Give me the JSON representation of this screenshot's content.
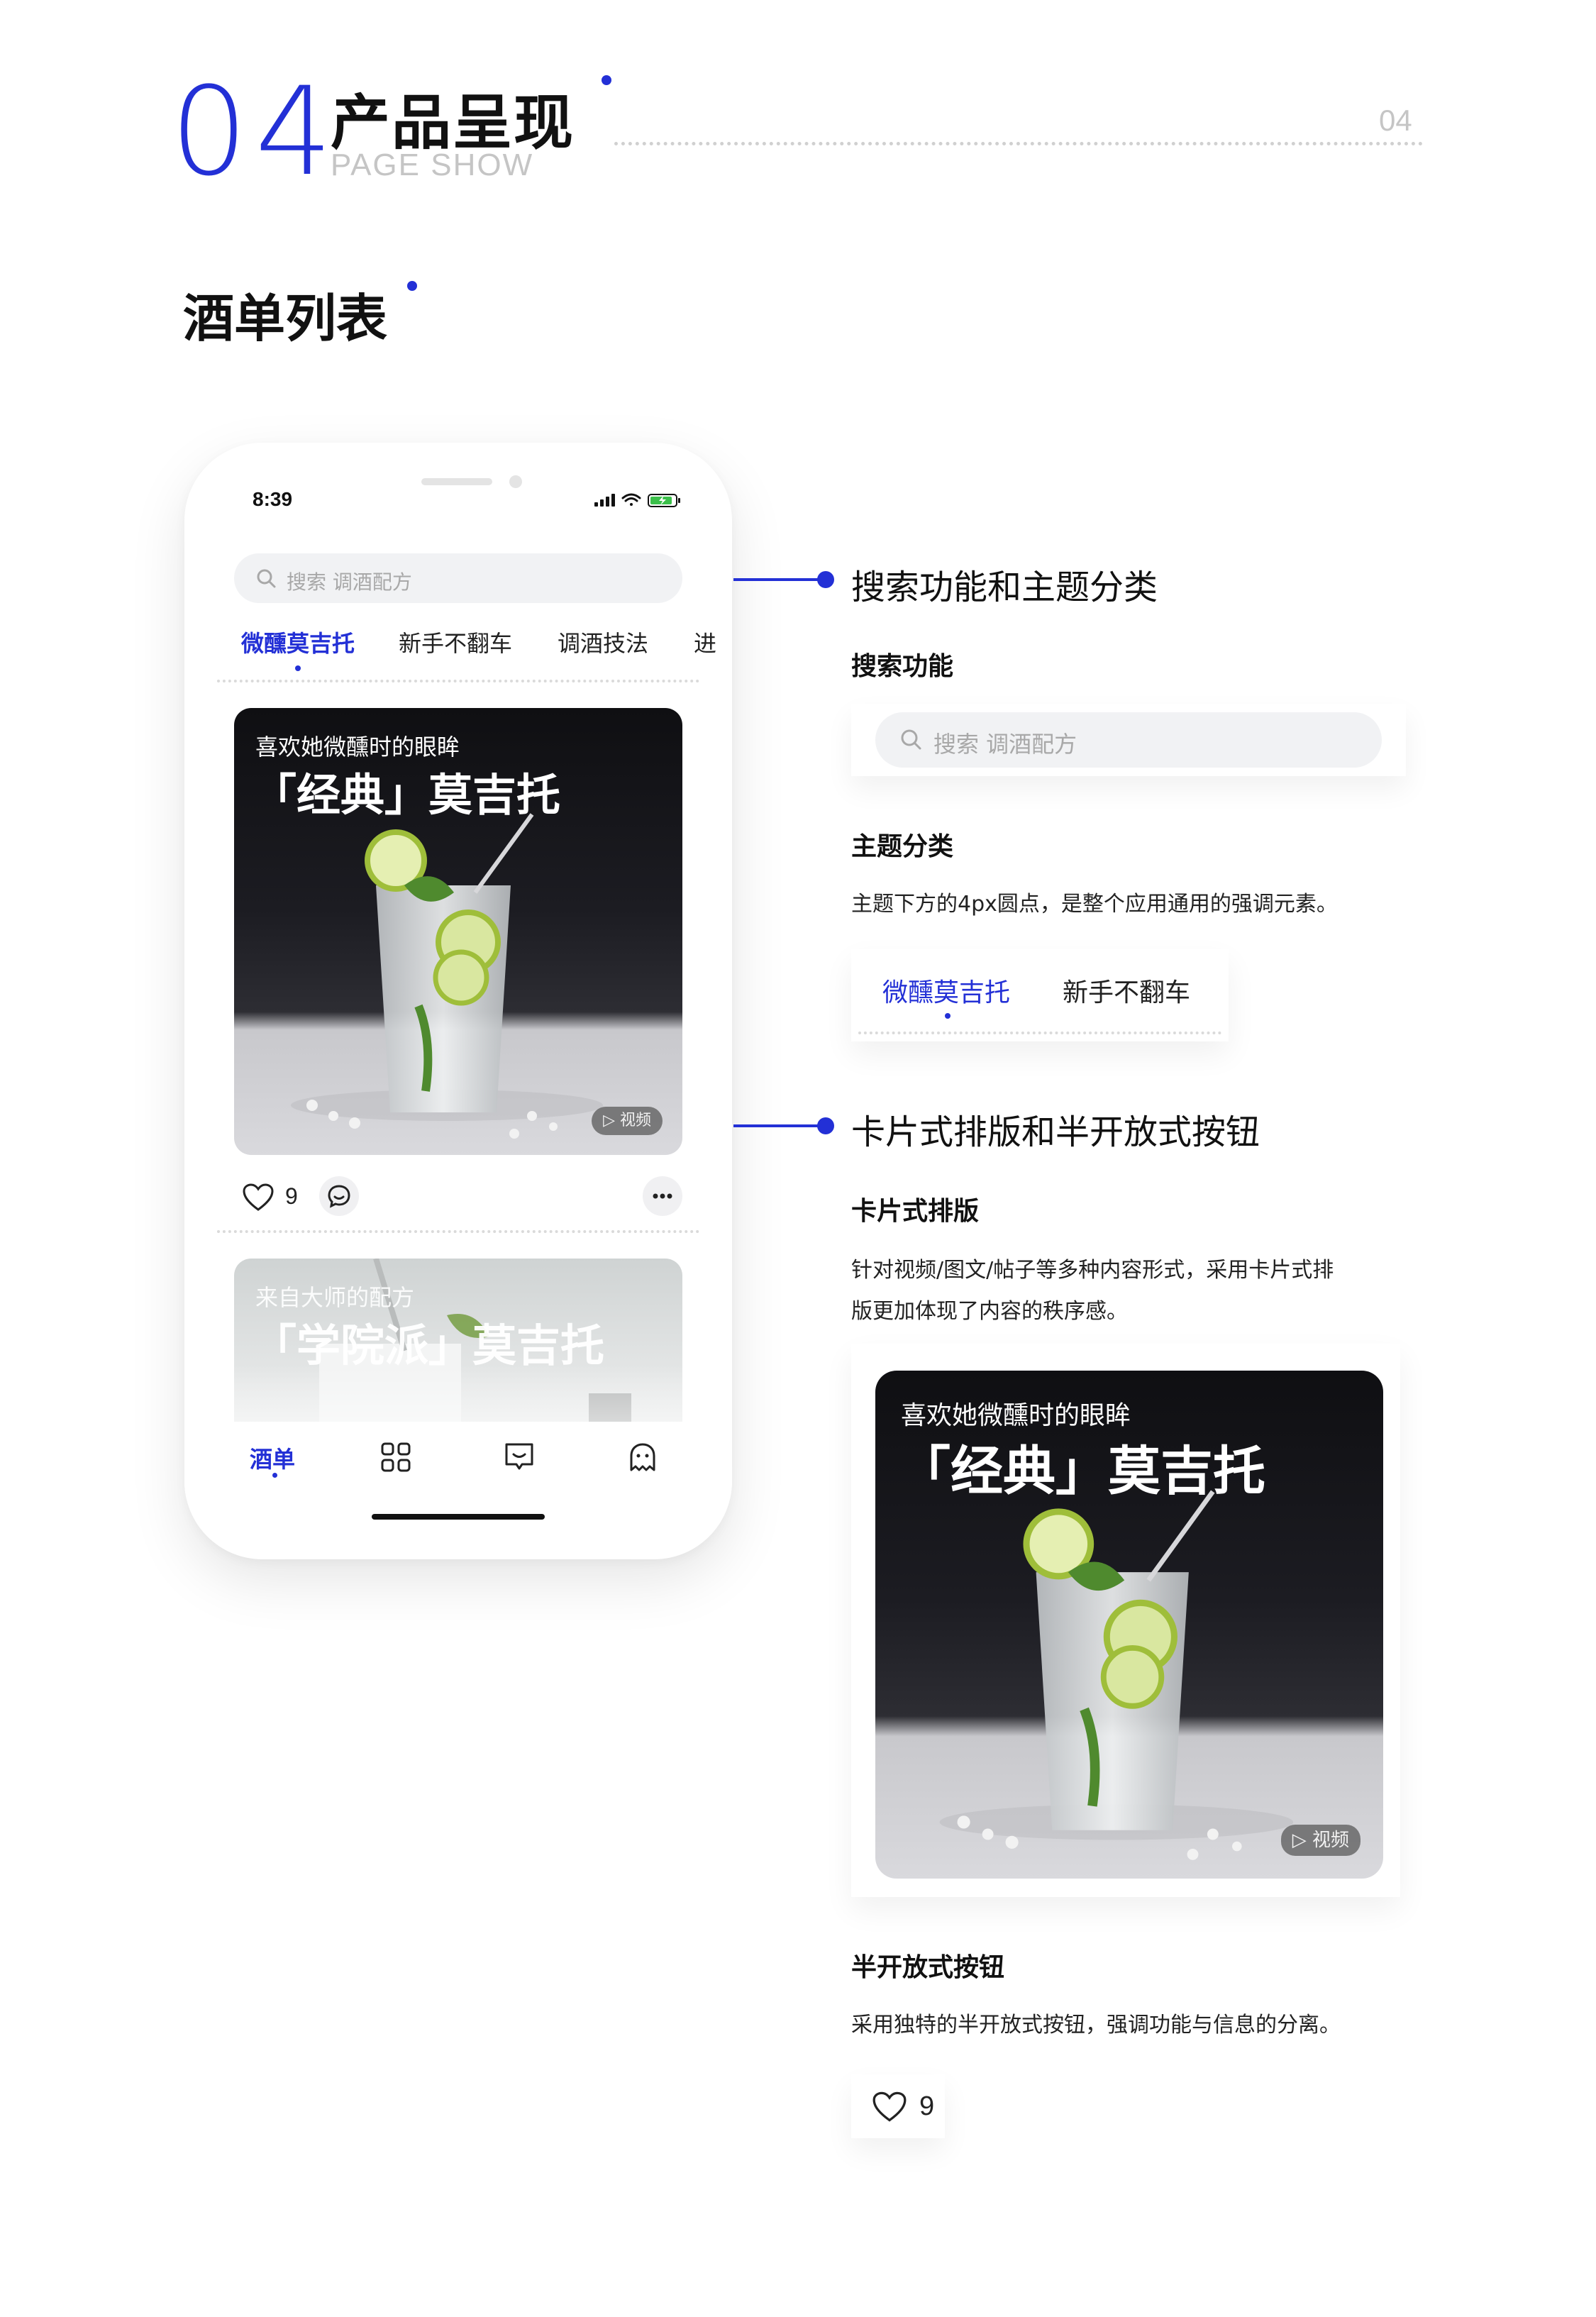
{
  "header": {
    "number": "04",
    "title": "产品呈现",
    "subtitle": "PAGE SHOW",
    "page_number": "04"
  },
  "section_title": "酒单列表",
  "phone": {
    "time": "8:39",
    "search_placeholder": "搜索 调酒配方",
    "tabs": [
      "微醺莫吉托",
      "新手不翻车",
      "调酒技法",
      "进"
    ],
    "active_tab": 0,
    "card1": {
      "subtitle": "喜欢她微醺时的眼眸",
      "title": "「经典」莫吉托",
      "badge": "视频"
    },
    "like_count": "9",
    "card2": {
      "subtitle": "来自大师的配方",
      "title": "「学院派」莫吉托"
    },
    "nav": {
      "active_label": "酒单",
      "icons": [
        "grid-icon",
        "chat-icon",
        "ghost-icon"
      ]
    }
  },
  "annotations": {
    "search_theme": {
      "heading": "搜索功能和主题分类",
      "search_label": "搜索功能",
      "search_placeholder": "搜索 调酒配方",
      "theme_label": "主题分类",
      "theme_desc": "主题下方的4px圆点，是整个应用通用的强调元素。",
      "theme_tabs": [
        "微醺莫吉托",
        "新手不翻车"
      ]
    },
    "card_layout": {
      "heading": "卡片式排版和半开放式按钮",
      "card_label": "卡片式排版",
      "card_desc_line1": "针对视频/图文/帖子等多种内容形式，采用卡片式排",
      "card_desc_line2": "版更加体现了内容的秩序感。",
      "card_subtitle": "喜欢她微醺时的眼眸",
      "card_title": "「经典」莫吉托",
      "card_badge": "视频",
      "button_label": "半开放式按钮",
      "button_desc": "采用独特的半开放式按钮，强调功能与信息的分离。",
      "like_count": "9"
    }
  },
  "colors": {
    "accent": "#2330d6",
    "text": "#111111",
    "muted": "#a8a8a8"
  }
}
